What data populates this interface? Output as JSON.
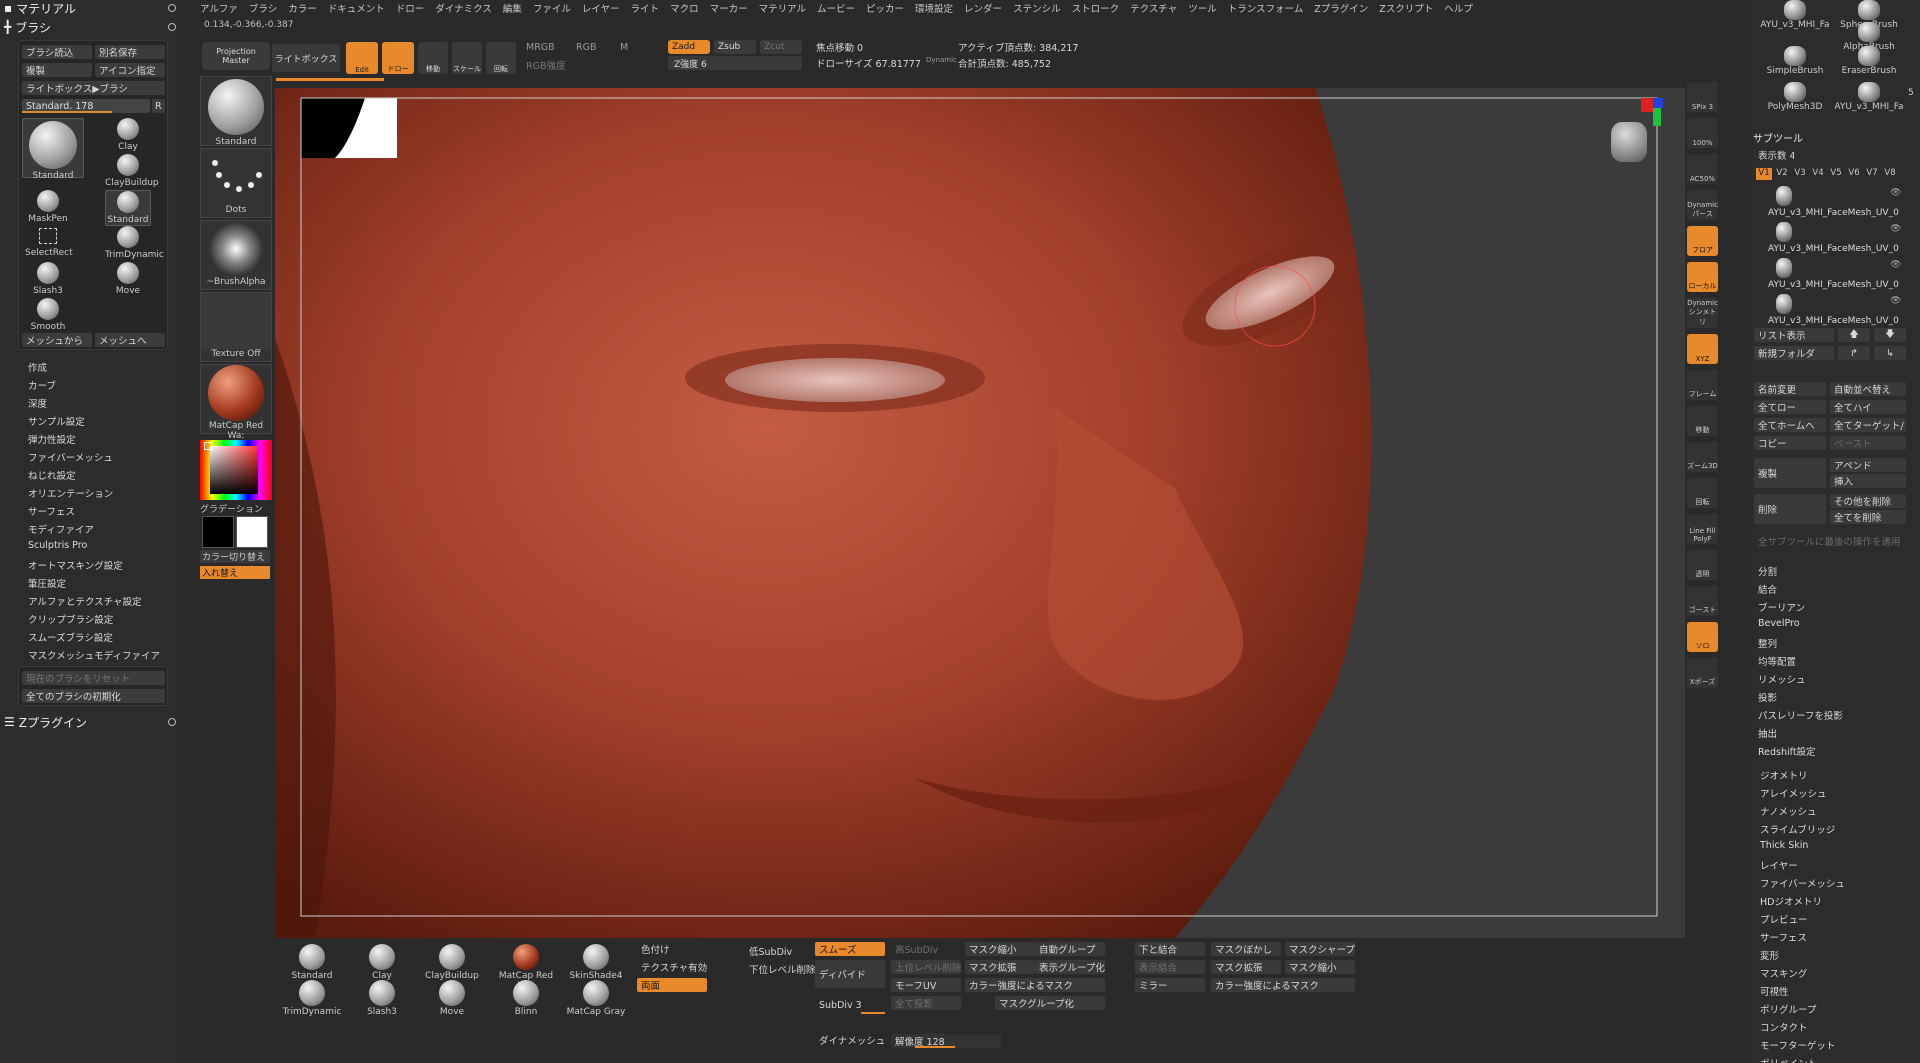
{
  "left": {
    "header_material": "マテリアル",
    "header_brush": "ブラシ",
    "btn_load": "ブラシ読込",
    "btn_saveas": "別名保存",
    "btn_clone": "複製",
    "btn_icon": "アイコン指定",
    "btn_lightbox": "ライトボックス▶ブラシ",
    "slider_label": "Standard. 178",
    "slider_value": 0.7,
    "slider_r": "R",
    "brushes": [
      "Standard",
      "Clay",
      "ClayBuildup",
      "MaskPen",
      "Standard",
      "SelectRect",
      "TrimDynamic",
      "Slash3",
      "Move",
      "Smooth"
    ],
    "btn_from_mesh": "メッシュから",
    "btn_to_mesh": "メッシュへ",
    "menu": [
      "作成",
      "カーブ",
      "深度",
      "サンプル設定",
      "弾力性設定",
      "ファイバーメッシュ",
      "ねじれ設定",
      "オリエンテーション",
      "サーフェス",
      "モディファイア",
      "Sculptris Pro",
      "オートマスキング設定",
      "筆圧設定",
      "アルファとテクスチャ設定",
      "クリップブラシ設定",
      "スムーズブラシ設定",
      "マスクメッシュモディファイア"
    ],
    "btn_reset": "現在のブラシをリセット",
    "btn_init": "全てのブラシの初期化",
    "header_zplugin": "Zプラグイン"
  },
  "col2": {
    "projection_master": "Projection Master",
    "tiles": [
      "Standard",
      "Dots",
      "~BrushAlpha",
      "Texture Off",
      "MatCap Red Wa:"
    ],
    "gradient": "グラデーション",
    "swap": "カラー切り替え",
    "replace": "入れ替え"
  },
  "menubar": [
    "アルファ",
    "ブラシ",
    "カラー",
    "ドキュメント",
    "ドロー",
    "ダイナミクス",
    "編集",
    "ファイル",
    "レイヤー",
    "ライト",
    "マクロ",
    "マーカー",
    "マテリアル",
    "ムービー",
    "ピッカー",
    "環境設定",
    "レンダー",
    "ステンシル",
    "ストローク",
    "テクスチャ",
    "ツール",
    "トランスフォーム",
    "Zプラグイン",
    "Zスクリプト",
    "ヘルプ"
  ],
  "coords": "0.134,-0.366,-0.387",
  "topbar": {
    "lightbox": "ライトボックス",
    "edit": "Edit",
    "draw": "ドロー",
    "move": "移動",
    "scale": "スケール",
    "rotate": "回転",
    "mrgb": "MRGB",
    "rgb": "RGB",
    "m": "M",
    "rgb_intensity": "RGB強度",
    "zadd": "Zadd",
    "zsub": "Zsub",
    "zcut": "Zcut",
    "z_intensity": "Z強度 6",
    "focal": "焦点移動 0",
    "draw_size": "ドローサイズ 67.81777",
    "dynamic": "Dynamic",
    "active_points": "アクティブ頂点数: 384,217",
    "total_points": "合計頂点数: 485,752"
  },
  "right_strip": [
    "SPix 3",
    "100%",
    "AC50%",
    "Dynamic パース",
    "フロア",
    "ローカル",
    "Dynamic シンメトリ",
    "XYZ",
    "フレーム",
    "移動",
    "ズーム3D",
    "回転",
    "Line Fill PolyF",
    "透明",
    "ゴースト",
    "ソロ",
    "Xポーズ"
  ],
  "right": {
    "brushes": [
      "AYU_v3_MHI_Fa",
      "SphereBrush",
      "AlphaBrush",
      "SimpleBrush",
      "EraserBrush",
      "PolyMesh3D",
      "AYU_v3_MHI_Fa"
    ],
    "count": "5",
    "subtool": "サブツール",
    "display_count": "表示数 4",
    "versions": [
      "V1",
      "V2",
      "V3",
      "V4",
      "V5",
      "V6",
      "V7",
      "V8"
    ],
    "subtools": [
      "AYU_v3_MHI_FaceMesh_UV_0",
      "AYU_v3_MHI_FaceMesh_UV_0",
      "AYU_v3_MHI_FaceMesh_UV_0",
      "AYU_v3_MHI_FaceMesh_UV_0"
    ],
    "list_view": "リスト表示",
    "new_folder": "新規フォルダ",
    "rename": "名前変更",
    "auto_sort": "自動並べ替え",
    "all_low": "全てロー",
    "all_high": "全てハイ",
    "all_home": "全てホームへ",
    "all_target": "全てターゲット/",
    "copy": "コピー",
    "paste": "ペースト",
    "duplicate": "複製",
    "append": "アペンド",
    "insert": "挿入",
    "delete": "削除",
    "delete_other": "その他を削除",
    "delete_all": "全てを削除",
    "apply_last": "全サブツールに最後の操作を適用",
    "items": [
      "分割",
      "結合",
      "ブーリアン",
      "BevelPro",
      "整列",
      "均等配置",
      "リメッシュ",
      "投影",
      "パスレリーフを投影",
      "抽出",
      "Redshift設定"
    ],
    "groups": [
      "ジオメトリ",
      "アレイメッシュ",
      "ナノメッシュ",
      "スライムブリッジ",
      "Thick Skin",
      "レイヤー",
      "ファイバーメッシュ",
      "HDジオメトリ",
      "プレビュー",
      "サーフェス",
      "変形",
      "マスキング",
      "可視性",
      "ポリグループ",
      "コンタクト",
      "モーフターゲット",
      "ポリペイント"
    ]
  },
  "bottom": {
    "brushes": [
      "Standard",
      "Clay",
      "ClayBuildup",
      "TrimDynamic",
      "Slash3",
      "Move"
    ],
    "mats": [
      "MatCap Red Wa:",
      "SkinShade4",
      "Blinn",
      "MatCap Gray"
    ],
    "col_color": "色付け",
    "tex_on": "テクスチャ有効",
    "double": "両面",
    "low_subdiv": "低SubDiv",
    "del_lower": "下位レベル削除",
    "smooth": "スムーズ",
    "divide": "ディバイド",
    "subdiv": "SubDiv 3",
    "dynamesh": "ダイナメッシュ",
    "high_subdiv": "高SubDiv",
    "del_higher": "上位レベル削除",
    "morph_uv": "モーフUV",
    "all_project": "全て投影",
    "mask_shrink": "マスク縮小",
    "mask_grow": "マスク拡張",
    "mask_by_intensity": "カラー強度によるマスク",
    "mask_group": "マスクグループ化",
    "auto_group": "自動グループ",
    "display_group": "表示グループ化",
    "merge_down": "下と結合",
    "display_merge": "表示結合",
    "mirror": "ミラー",
    "mask_blur": "マスクぼかし",
    "mask_sharpen": "マスクシャープ",
    "mask_expand": "マスク拡張",
    "mask_reduce": "マスク縮小",
    "mask_color": "カラー強度によるマスク",
    "resolution": "解像度 128"
  }
}
